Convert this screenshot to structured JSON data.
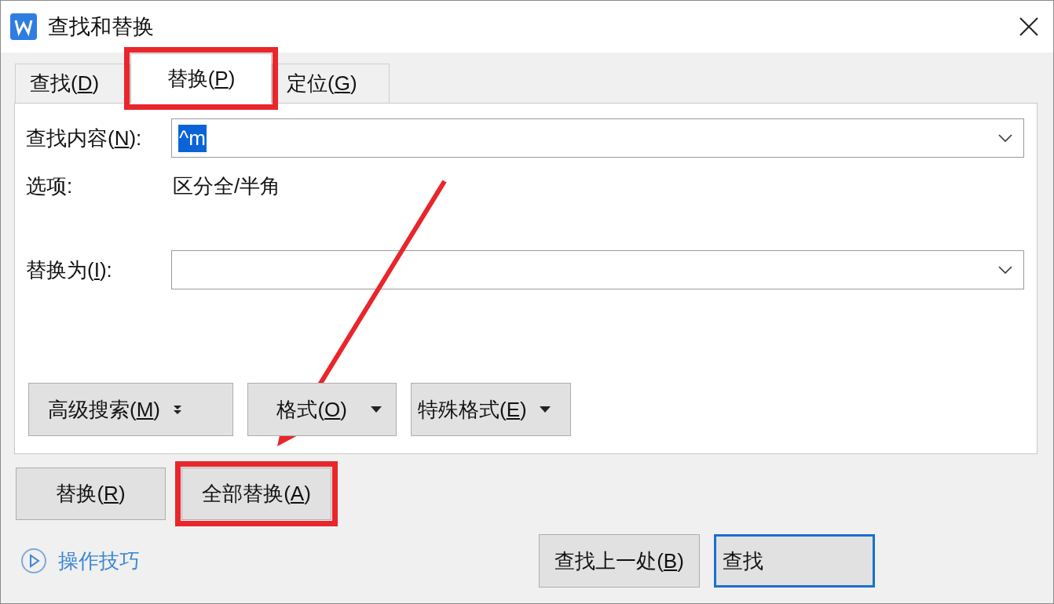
{
  "window": {
    "title": "查找和替换"
  },
  "tabs": [
    {
      "label": "查找(D)",
      "selected": false,
      "highlighted": false
    },
    {
      "label": "替换(P)",
      "selected": true,
      "highlighted": true
    },
    {
      "label": "定位(G)",
      "selected": false,
      "highlighted": false
    }
  ],
  "find_field": {
    "label": "查找内容(N):",
    "value": "^m",
    "value_selected": true
  },
  "options": {
    "label": "选项:",
    "value": "区分全/半角"
  },
  "replace_field": {
    "label": "替换为(I):"
  },
  "panel_buttons": [
    {
      "label": "高级搜索(M)",
      "kind": "expand"
    },
    {
      "label": "格式(O)",
      "kind": "dropdown"
    },
    {
      "label": "特殊格式(E)",
      "kind": "dropdown"
    }
  ],
  "action_buttons": [
    {
      "label": "替换(R)",
      "highlighted": false
    },
    {
      "label": "全部替换(A)",
      "highlighted": true
    }
  ],
  "tips_link": "操作技巧",
  "footer_buttons": [
    {
      "label": "查找上一处(B)",
      "default": false
    },
    {
      "label": "查找",
      "default": true
    }
  ]
}
